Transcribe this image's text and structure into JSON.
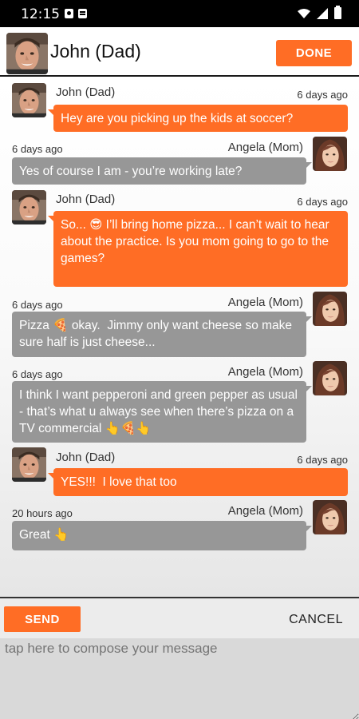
{
  "status_bar": {
    "time": "12:15"
  },
  "header": {
    "contact_name": "John (Dad)",
    "done_label": "DONE"
  },
  "messages": [
    {
      "sender": "John (Dad)",
      "time": "6 days ago",
      "text": "Hey are you picking up the kids at soccer?",
      "direction": "out"
    },
    {
      "sender": "Angela (Mom)",
      "time": "6 days ago",
      "text": "Yes of course I am - you’re working late?",
      "direction": "in"
    },
    {
      "sender": "John (Dad)",
      "time": "6 days ago",
      "text": "So... 😎 I’ll bring home pizza... I can’t wait to hear about the practice. Is you mom going to go to the games?",
      "direction": "out"
    },
    {
      "sender": "Angela (Mom)",
      "time": "6 days ago",
      "text": "Pizza 🍕 okay.  Jimmy only want cheese so make sure half is just cheese...",
      "direction": "in"
    },
    {
      "sender": "Angela (Mom)",
      "time": "6 days ago",
      "text": "I think I want pepperoni and green pepper as usual - that’s what u always see when there’s pizza on a TV commercial 👆🍕👆",
      "direction": "in"
    },
    {
      "sender": "John (Dad)",
      "time": "6 days ago",
      "text": "YES!!!  I love that too",
      "direction": "out"
    },
    {
      "sender": "Angela (Mom)",
      "time": "20 hours ago",
      "text": "Great 👆",
      "direction": "in"
    }
  ],
  "compose": {
    "send_label": "SEND",
    "cancel_label": "CANCEL",
    "placeholder": "tap here to compose your message"
  },
  "colors": {
    "accent": "#ff6d25",
    "incoming_bubble": "#979797"
  }
}
